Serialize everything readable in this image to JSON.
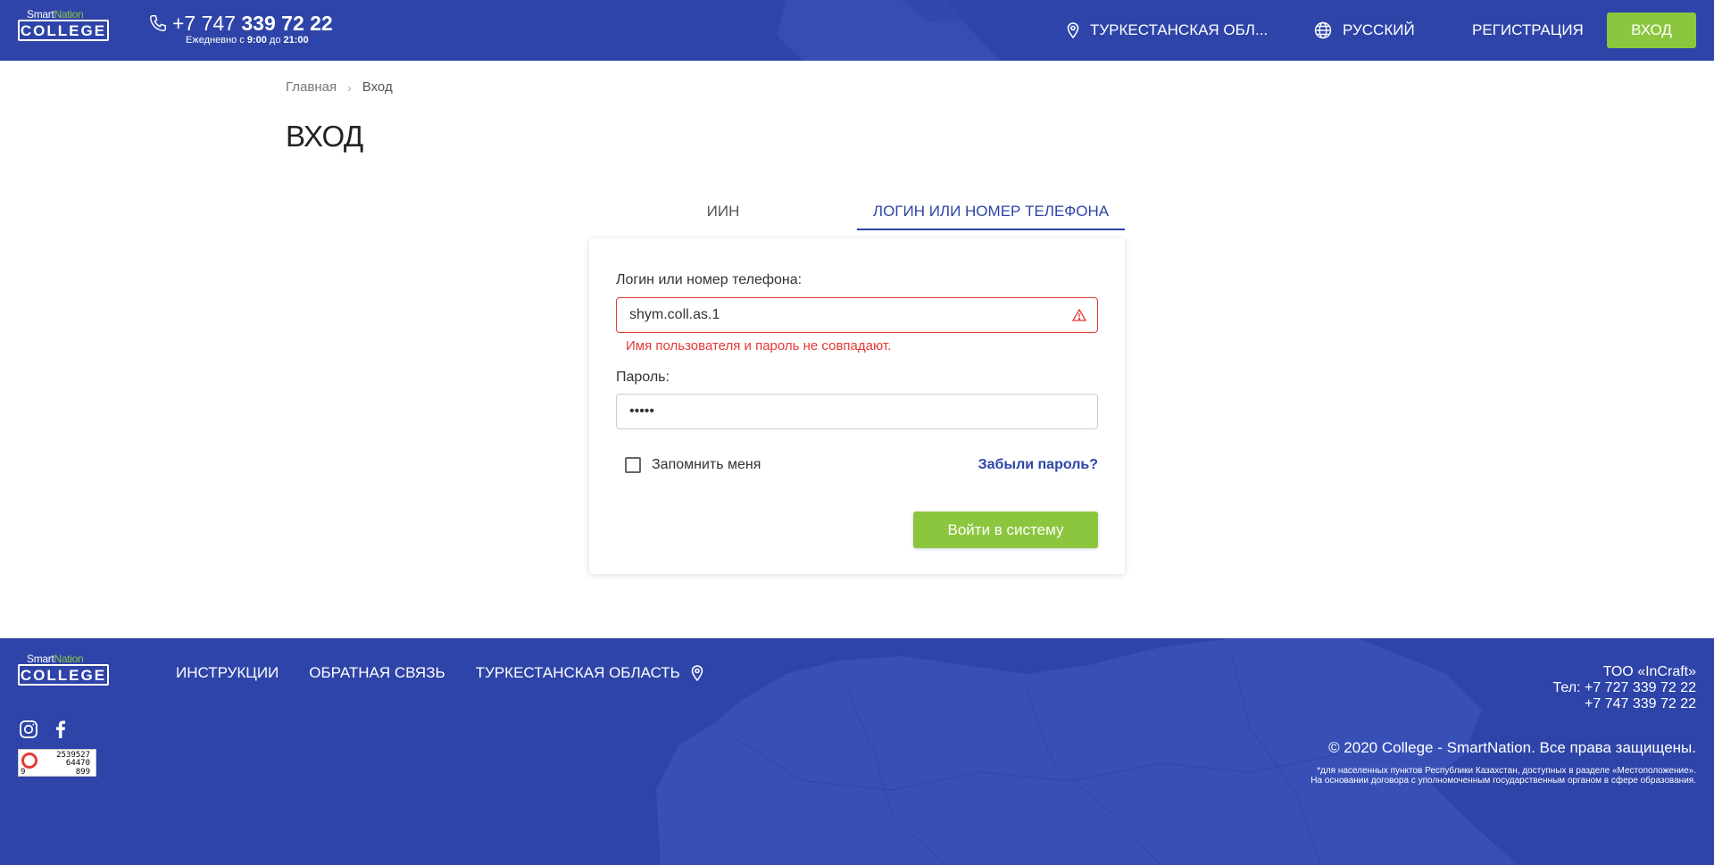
{
  "header": {
    "logo_top_left": "Smart",
    "logo_top_right": "Nation",
    "logo_main": "COLLEGE",
    "phone_prefix": "+7 747 ",
    "phone_main": "339 72 22",
    "hours_prefix": "Ежедневно с ",
    "hours_from": "9:00",
    "hours_mid": " до ",
    "hours_to": "21:00",
    "region": "ТУРКЕСТАНСКАЯ ОБЛ...",
    "language": "РУССКИЙ",
    "register": "РЕГИСТРАЦИЯ",
    "login": "ВХОД"
  },
  "breadcrumb": {
    "home": "Главная",
    "current": "Вход"
  },
  "page_title": "ВХОД",
  "tabs": [
    {
      "label": "ИИН",
      "active": false
    },
    {
      "label": "ЛОГИН ИЛИ НОМЕР ТЕЛЕФОНА",
      "active": true
    }
  ],
  "form": {
    "login_label": "Логин или номер телефона:",
    "login_value": "shym.coll.as.1",
    "error_message": "Имя пользователя и пароль не совпадают.",
    "password_label": "Пароль:",
    "password_value": "•••••",
    "remember_label": "Запомнить меня",
    "remember_checked": false,
    "forgot_label": "Забыли пароль?",
    "submit_label": "Войти в систему"
  },
  "footer": {
    "nav": [
      "ИНСТРУКЦИИ",
      "ОБРАТНАЯ СВЯЗЬ"
    ],
    "region": "ТУРКЕСТАНСКАЯ ОБЛАСТЬ",
    "company": "ТОО «InCraft»",
    "tel1": "Тел: +7 727 339 72 22",
    "tel2": "+7 747 339 72 22",
    "copyright": "© 2020 College - SmartNation. Все права защищены.",
    "note1": "*для населенных пунктов Республики Казахстан, доступных в разделе «Местоположение».",
    "note2": "На основании договора с уполномоченным государственным органом в сфере образования.",
    "counter": [
      "2539527",
      "64470",
      "9",
      "899"
    ]
  },
  "colors": {
    "brand_blue": "#2e44a8",
    "accent_green": "#8cc63f",
    "error_red": "#e53935"
  }
}
